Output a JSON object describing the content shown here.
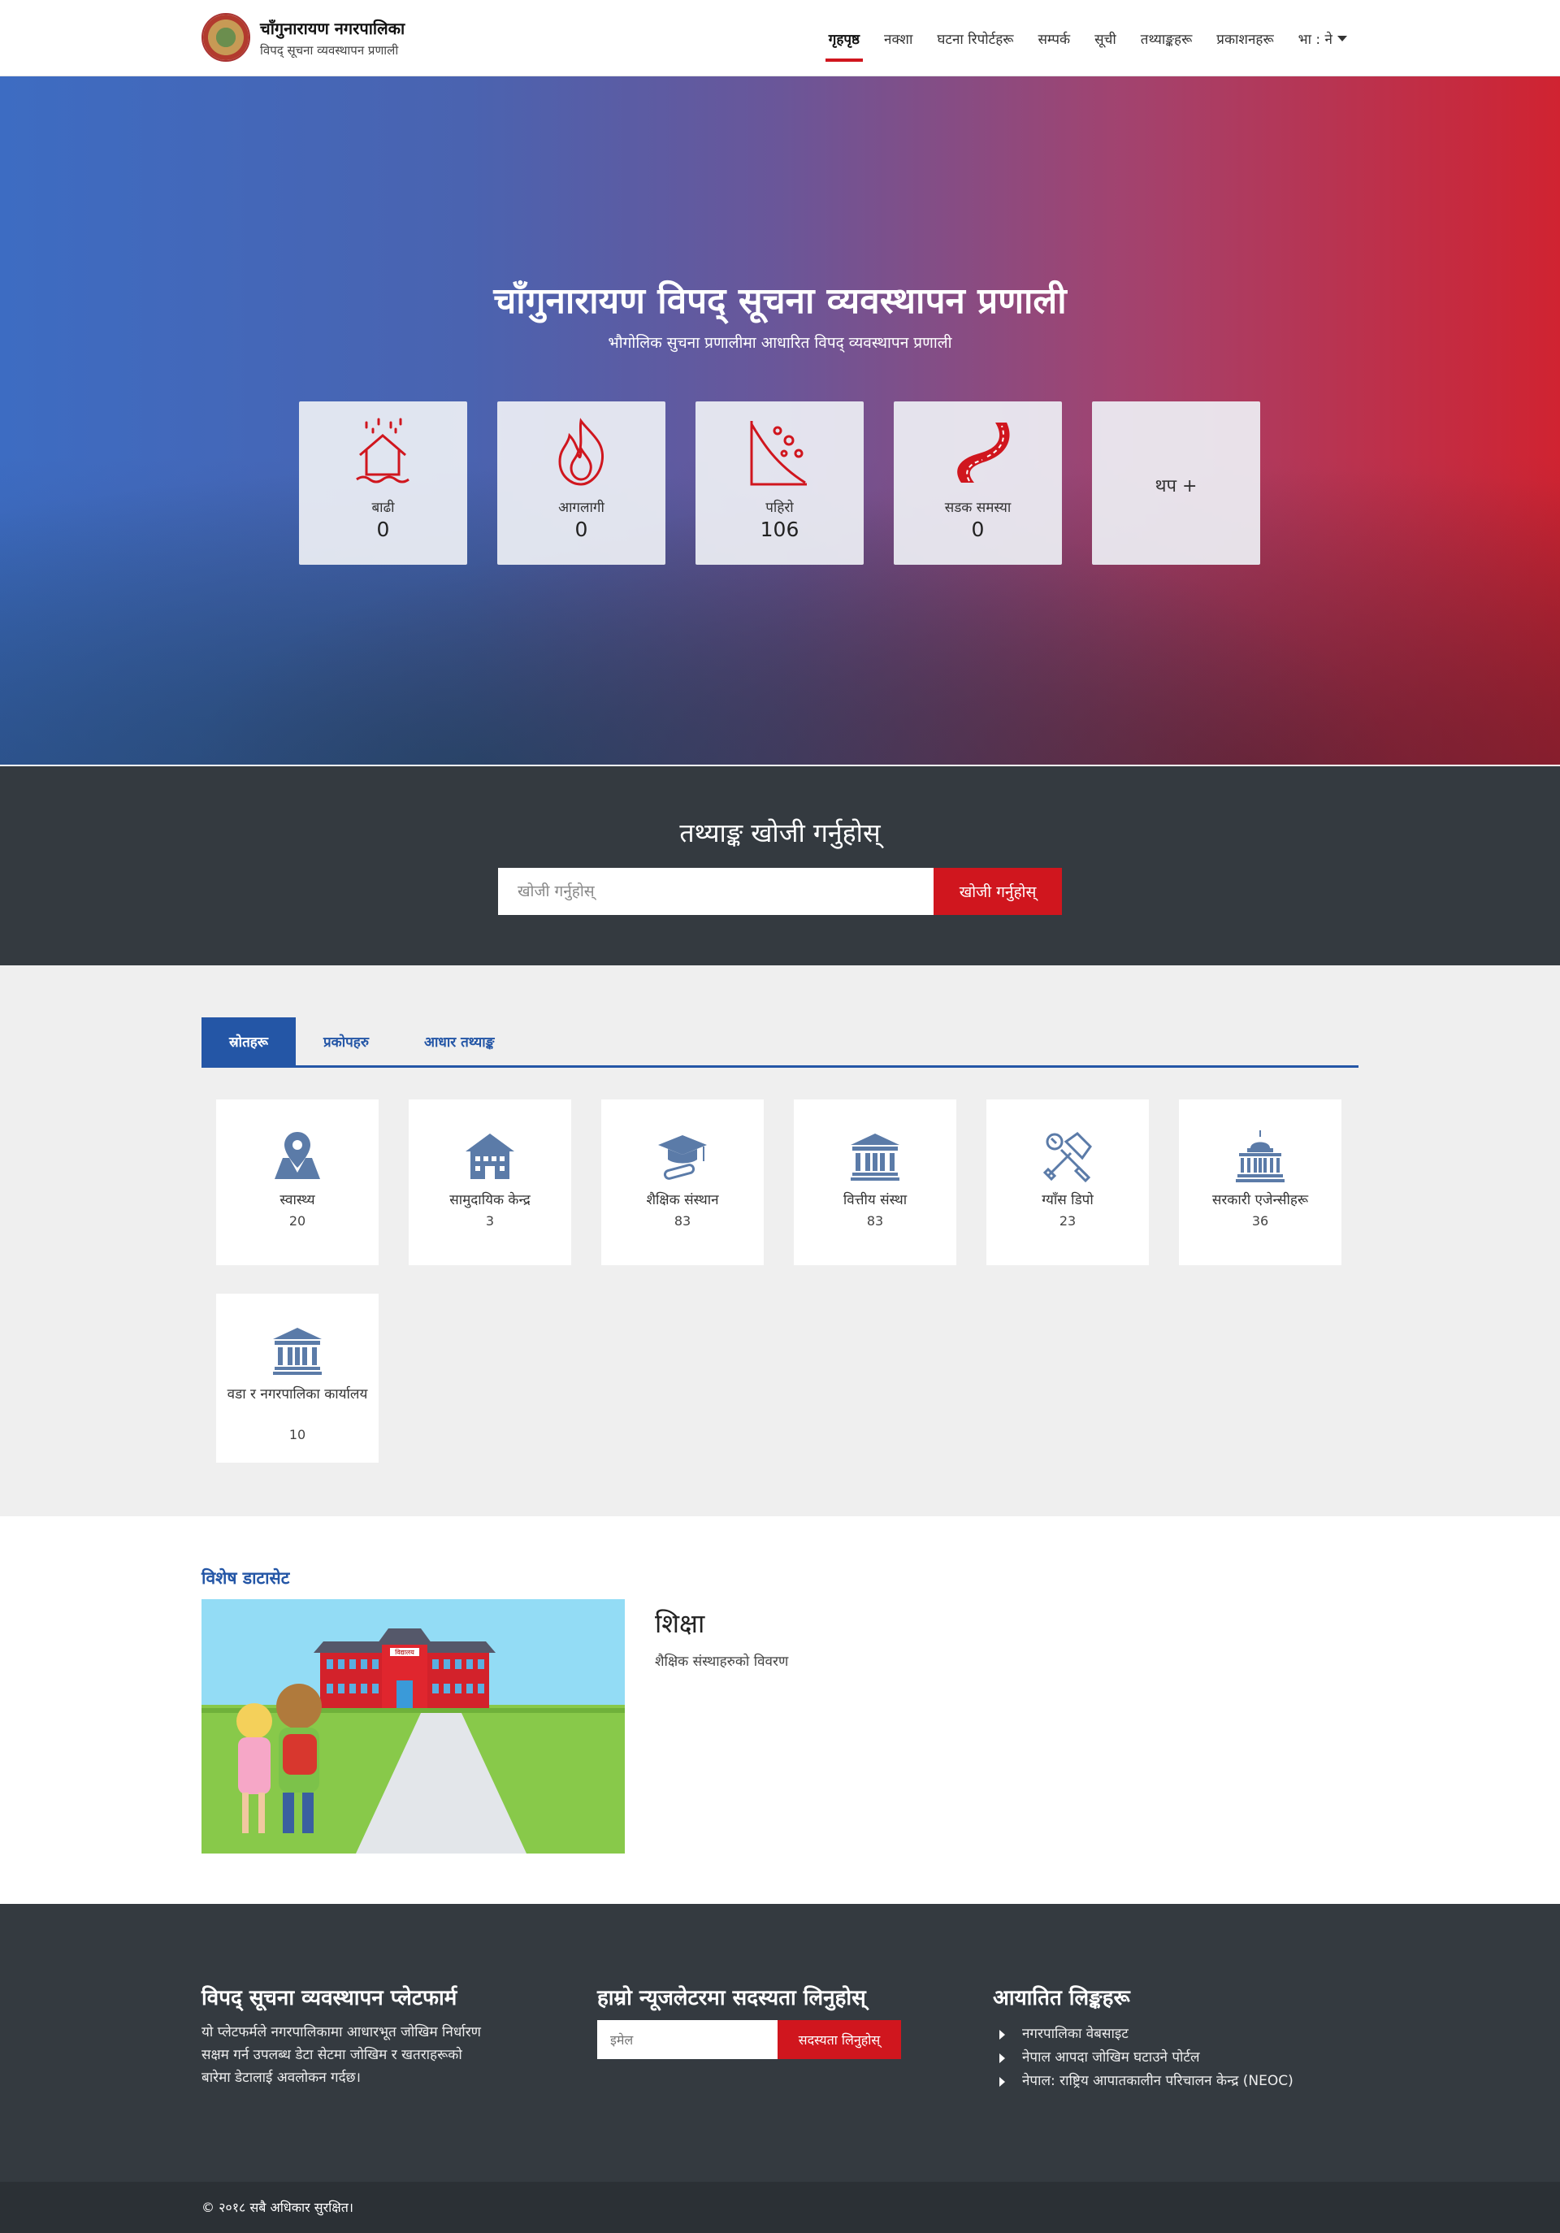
{
  "header": {
    "title": "चाँगुनारायण नगरपालिका",
    "subtitle": "विपद् सूचना व्यवस्थापन प्रणाली",
    "nav": [
      "गृहपृष्ठ",
      "नक्शा",
      "घटना रिपोर्टहरू",
      "सम्पर्क",
      "सूची",
      "तथ्याङ्कहरू",
      "प्रकाशनहरू"
    ],
    "language": "भा : ने"
  },
  "hero": {
    "title": "चाँगुनारायण विपद् सूचना व्यवस्थापन प्रणाली",
    "subtitle": "भौगोलिक सुचना प्रणालीमा आधारित विपद् व्यवस्थापन प्रणाली",
    "hazards": [
      {
        "label": "बाढी",
        "value": "0",
        "icon": "flood-icon"
      },
      {
        "label": "आगलागी",
        "value": "0",
        "icon": "fire-icon"
      },
      {
        "label": "पहिरो",
        "value": "106",
        "icon": "landslide-icon"
      },
      {
        "label": "सडक समस्या",
        "value": "0",
        "icon": "road-icon"
      }
    ],
    "more_label": "थप +",
    "accent": "#d0161e"
  },
  "search": {
    "title": "तथ्याङ्क खोजी गर्नुहोस्",
    "placeholder": "खोजी गर्नुहोस्",
    "button": "खोजी गर्नुहोस्"
  },
  "resources": {
    "tabs": [
      "स्रोतहरू",
      "प्रकोपहरु",
      "आधार तथ्याङ्क"
    ],
    "items": [
      {
        "name": "स्वास्थ्य",
        "count": "20",
        "icon": "map-pin-icon"
      },
      {
        "name": "सामुदायिक केन्द्र",
        "count": "3",
        "icon": "community-building-icon"
      },
      {
        "name": "शैक्षिक संस्थान",
        "count": "83",
        "icon": "graduation-cap-icon"
      },
      {
        "name": "वित्तीय संस्था",
        "count": "83",
        "icon": "bank-icon"
      },
      {
        "name": "ग्याँस डिपो",
        "count": "23",
        "icon": "tools-icon"
      },
      {
        "name": "सरकारी एजेन्सीहरू",
        "count": "36",
        "icon": "capitol-icon"
      },
      {
        "name": "वडा र नगरपालिका कार्यालय",
        "count": "10",
        "icon": "bank-icon"
      }
    ],
    "tab_color": "#2456a6"
  },
  "featured": {
    "section_title": "विशेष डाटासेट",
    "name": "शिक्षा",
    "description": "शैक्षिक संस्थाहरुको विवरण",
    "school_sign": "विद्यालय"
  },
  "footer": {
    "about_title": "विपद् सूचना व्यवस्थापन प्लेटफार्म",
    "about_text": "यो प्लेटफर्मले नगरपालिकामा आधारभूत जोखिम निर्धारण सक्षम गर्न उपलब्ध डेटा सेटमा जोखिम र खतराहरूको बारेमा डेटालाई अवलोकन गर्दछ।",
    "newsletter_title": "हाम्रो न्यूजलेटरमा सदस्यता लिनुहोस्",
    "newsletter_placeholder": "इमेल",
    "newsletter_button": "सदस्यता लिनुहोस्",
    "links_title": "आयातित लिङ्कहरू",
    "links": [
      "नगरपालिका वेबसाइट",
      "नेपाल आपदा जोखिम घटाउने पोर्टल",
      "नेपाल: राष्ट्रिय आपातकालीन परिचालन केन्द्र (NEOC)"
    ],
    "copyright": "© २०१८   सबै अधिकार सुरक्षित।"
  }
}
